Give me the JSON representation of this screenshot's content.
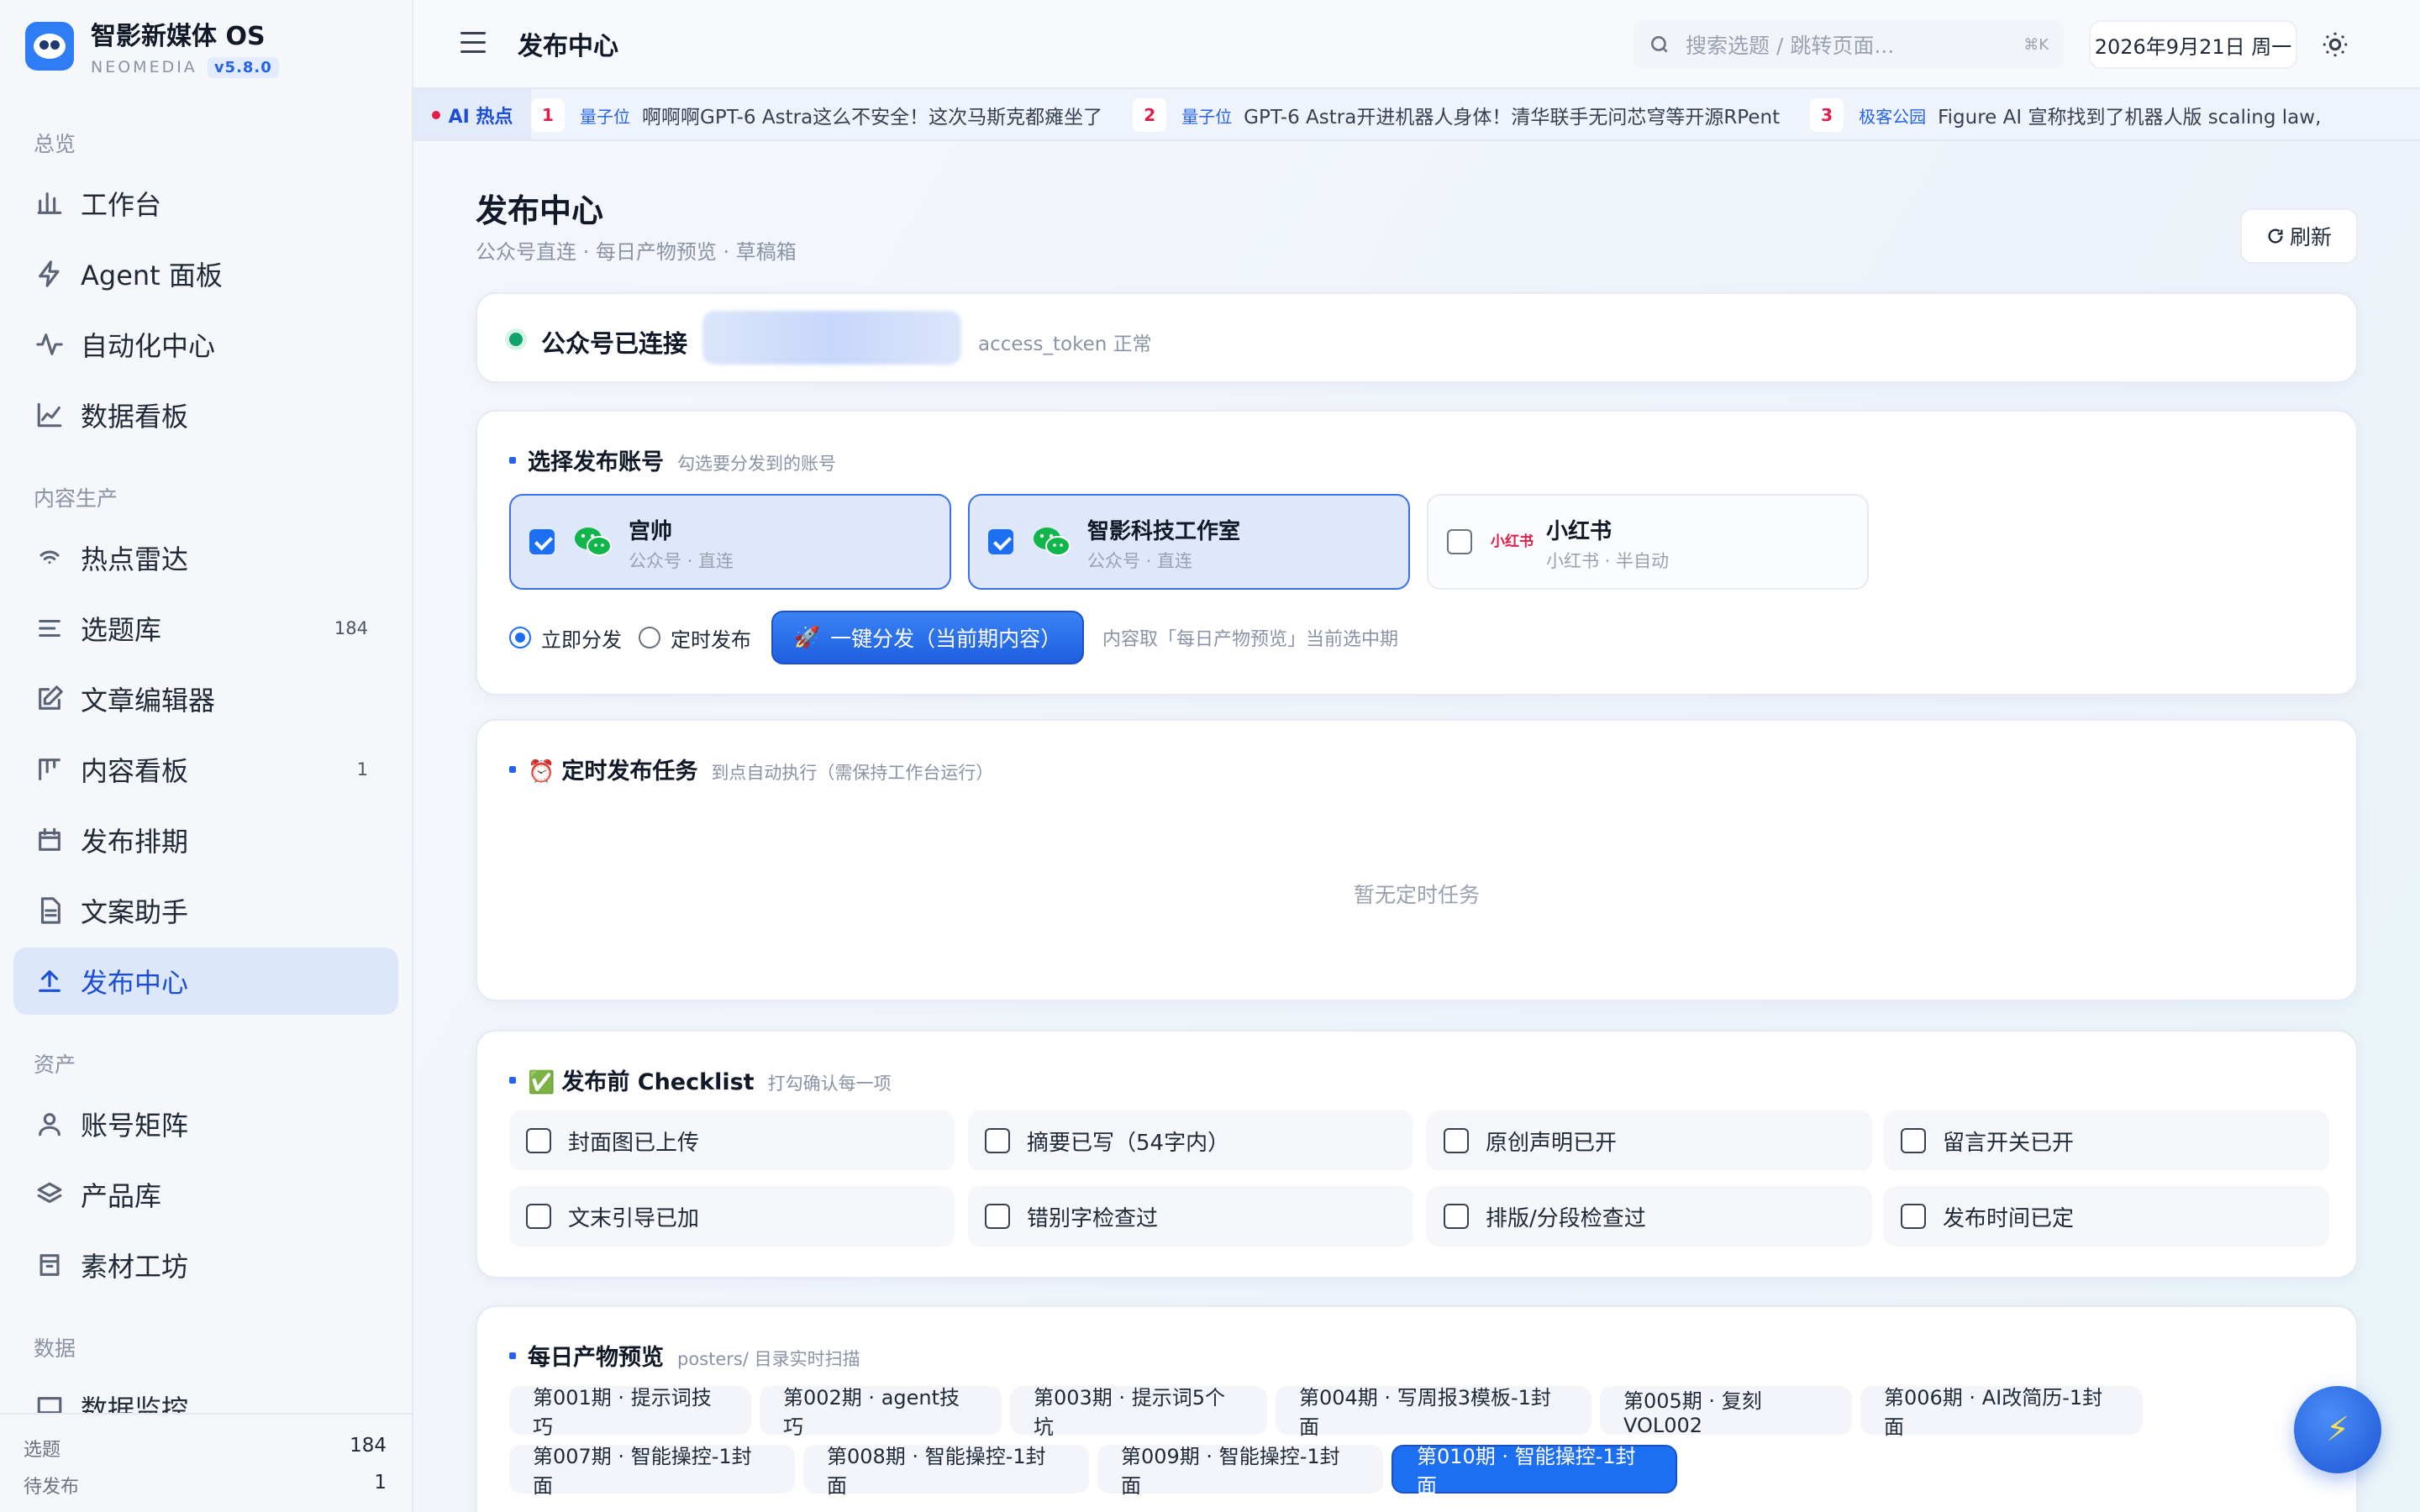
{
  "brand": {
    "name": "智影新媒体 OS",
    "sub": "NEOMEDIA",
    "version": "v5.8.0"
  },
  "sidebar": {
    "groups": [
      "总览",
      "内容生产",
      "资产",
      "数据"
    ],
    "overview": [
      {
        "label": "工作台",
        "icon": "bar-chart-icon"
      },
      {
        "label": "Agent 面板",
        "icon": "lightning-icon"
      },
      {
        "label": "自动化中心",
        "icon": "activity-icon"
      },
      {
        "label": "数据看板",
        "icon": "line-chart-icon"
      }
    ],
    "production": [
      {
        "label": "热点雷达",
        "icon": "radar-icon"
      },
      {
        "label": "选题库",
        "icon": "list-icon",
        "count": "184"
      },
      {
        "label": "文章编辑器",
        "icon": "edit-icon"
      },
      {
        "label": "内容看板",
        "icon": "kanban-icon",
        "count": "1"
      },
      {
        "label": "发布排期",
        "icon": "calendar-icon"
      },
      {
        "label": "文案助手",
        "icon": "document-icon"
      },
      {
        "label": "发布中心",
        "icon": "upload-icon"
      }
    ],
    "assets": [
      {
        "label": "账号矩阵",
        "icon": "user-icon"
      },
      {
        "label": "产品库",
        "icon": "layers-icon"
      },
      {
        "label": "素材工坊",
        "icon": "archive-icon"
      }
    ],
    "data_partial": "数据监控",
    "footer": [
      {
        "label": "选题",
        "value": "184"
      },
      {
        "label": "待发布",
        "value": "1"
      }
    ]
  },
  "topbar": {
    "title": "发布中心",
    "search_placeholder": "搜索选题 / 跳转页面...",
    "shortcut": "⌘K",
    "date": "2026年9月21日 周一"
  },
  "ticker": {
    "tag": "AI 热点",
    "items": [
      {
        "num": "1",
        "source": "量子位",
        "text": "啊啊啊GPT-6 Astra这么不安全！这次马斯克都瘫坐了"
      },
      {
        "num": "2",
        "source": "量子位",
        "text": "GPT-6 Astra开进机器人身体！清华联手无问芯穹等开源RPent"
      },
      {
        "num": "3",
        "source": "极客公园",
        "text": "Figure AI 宣称找到了机器人版 scaling law,"
      }
    ]
  },
  "page": {
    "title": "发布中心",
    "subtitle": "公众号直连 · 每日产物预览 · 草稿箱",
    "refresh": "刷新"
  },
  "connection": {
    "label": "公众号已连接",
    "token_status": "access_token 正常"
  },
  "accounts": {
    "title": "选择发布账号",
    "hint": "勾选要分发到的账号",
    "items": [
      {
        "name": "宫帅",
        "sub": "公众号 · 直连",
        "checked": true
      },
      {
        "name": "智影科技工作室",
        "sub": "公众号 · 直连",
        "checked": true
      },
      {
        "name": "小红书",
        "sub": "小红书 · 半自动",
        "checked": false,
        "logo": "小红书"
      }
    ],
    "mode_now": "立即分发",
    "mode_scheduled": "定时发布",
    "publish_button": "一键分发（当前期内容）",
    "rocket": "🚀",
    "note": "内容取「每日产物预览」当前选中期"
  },
  "scheduled": {
    "emoji": "⏰",
    "title": "定时发布任务",
    "hint": "到点自动执行（需保持工作台运行）",
    "empty": "暂无定时任务"
  },
  "checklist": {
    "emoji": "✅",
    "title": "发布前 Checklist",
    "hint": "打勾确认每一项",
    "items": [
      "封面图已上传",
      "摘要已写（54字内）",
      "原创声明已开",
      "留言开关已开",
      "文末引导已加",
      "错别字检查过",
      "排版/分段检查过",
      "发布时间已定"
    ]
  },
  "preview": {
    "title": "每日产物预览",
    "hint": "posters/ 目录实时扫描",
    "issues": [
      "第001期 · 提示词技巧",
      "第002期 · agent技巧",
      "第003期 · 提示词5个坑",
      "第004期 · 写周报3模板-1封面",
      "第005期 · 复刻VOL002",
      "第006期 · AI改简历-1封面",
      "第007期 · 智能操控-1封面",
      "第008期 · 智能操控-1封面",
      "第009期 · 智能操控-1封面",
      "第010期 · 智能操控-1封面"
    ],
    "selected_index": 9
  },
  "fab": "⚡",
  "colors": {
    "accent": "#1d6ff2",
    "connected": "#10a36b",
    "hot": "#e11d48"
  }
}
